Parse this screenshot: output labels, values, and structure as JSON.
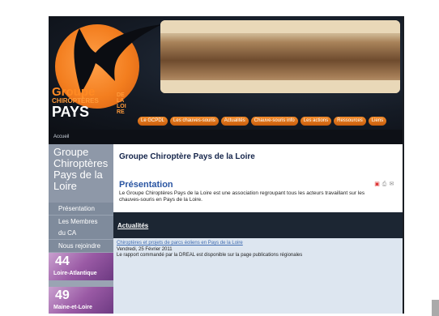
{
  "header": {
    "logo": {
      "line1": "Groupe",
      "line2": "CHIROPTÈRES",
      "line3": "PAYS",
      "line4": "DE LA LOIRE"
    },
    "nav": [
      "Le GCPDL",
      "Les chauves-souris",
      "Actualités",
      "Chauve-souris info",
      "Les actions",
      "Ressources",
      "Liens"
    ]
  },
  "breadcrumb": "Accueil",
  "sidebar": {
    "title": "Groupe Chiroptères Pays de la Loire",
    "items": [
      "Présentation",
      "Les Membres du CA",
      "Nous rejoindre"
    ],
    "regions": [
      {
        "number": "44",
        "name": "Loire-Atlantique"
      },
      {
        "number": "49",
        "name": "Maine-et-Loire"
      }
    ]
  },
  "main": {
    "title": "Groupe Chiroptère Pays de la Loire",
    "section_title": "Présentation",
    "intro": "Le Groupe Chiroptères Pays de la Loire est une association regroupant tous les acteurs travaillant sur les chauves-souris en Pays de la Loire.",
    "news_bar": "Actualités",
    "news": {
      "link": "Chiroptères et projets de parcs éoliens en Pays de la Loire",
      "date": "Vendredi, 25 Février 2011",
      "text": "Le rapport commandé par la DREAL est disponible sur la page publications régionales"
    }
  },
  "colors": {
    "accent": "#f28b2b",
    "heading": "#2a55a2",
    "frame_heading": "#b52b2b"
  }
}
